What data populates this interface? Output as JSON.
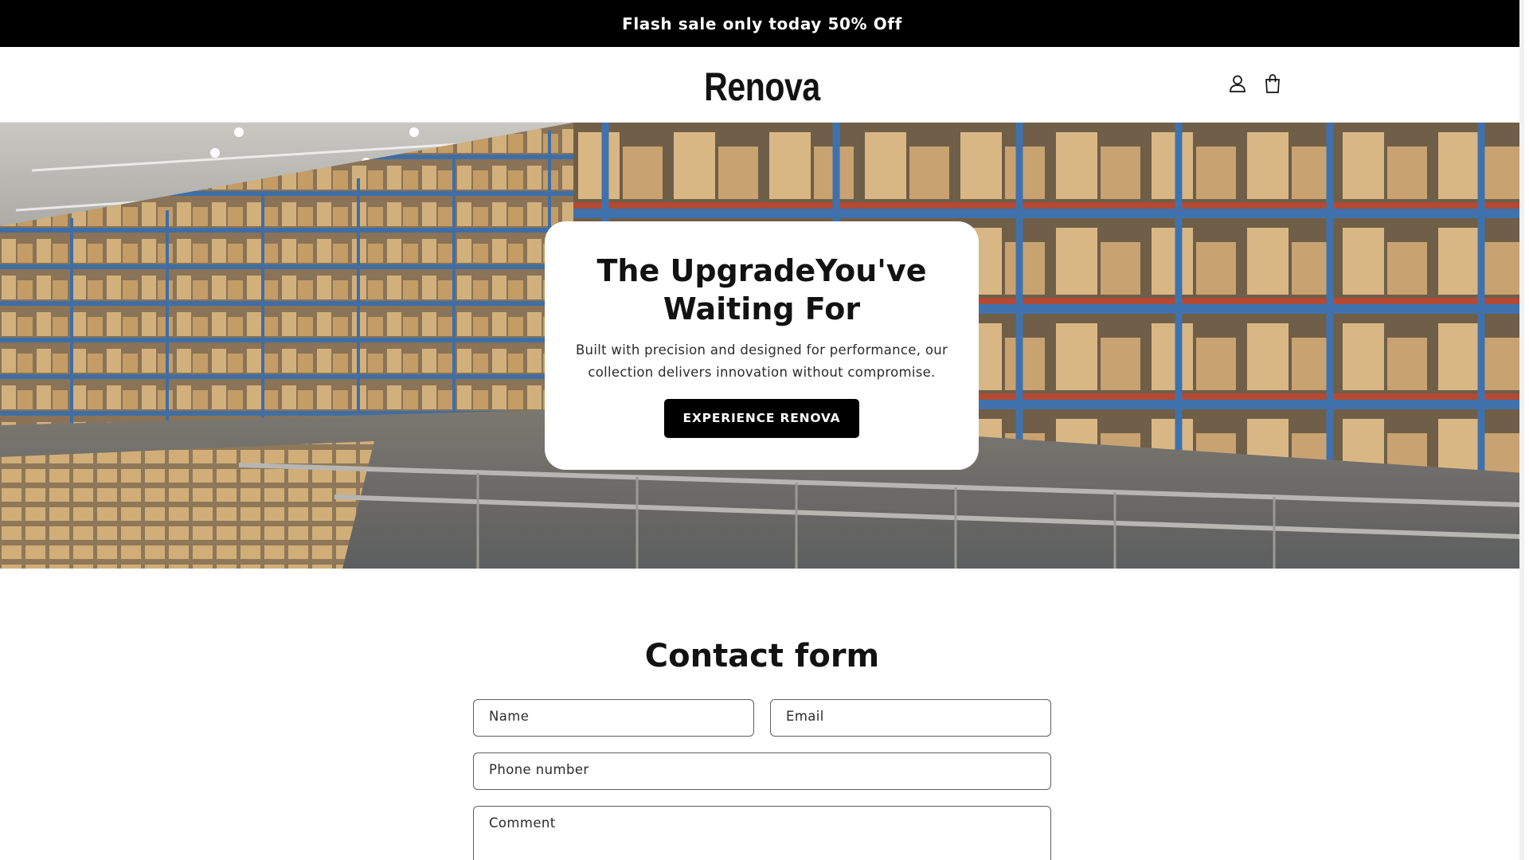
{
  "announcement": {
    "text": "Flash sale only today 50% Off"
  },
  "header": {
    "logo": "Renova",
    "icons": [
      "account-icon",
      "cart-icon"
    ]
  },
  "hero": {
    "title_line1": "The UpgradeYou've",
    "title_line2": "Waiting For",
    "subtitle_line1": "Built with precision and designed for performance, our",
    "subtitle_line2": "collection delivers innovation without compromise.",
    "button_label": "EXPERIENCE RENOVA"
  },
  "contact": {
    "title": "Contact form",
    "name_placeholder": "Name",
    "email_placeholder": "Email",
    "phone_placeholder": "Phone number",
    "comment_placeholder": "Comment"
  },
  "colors": {
    "announcement_bg": "#000000",
    "button_bg": "#000000",
    "text": "#121212"
  }
}
